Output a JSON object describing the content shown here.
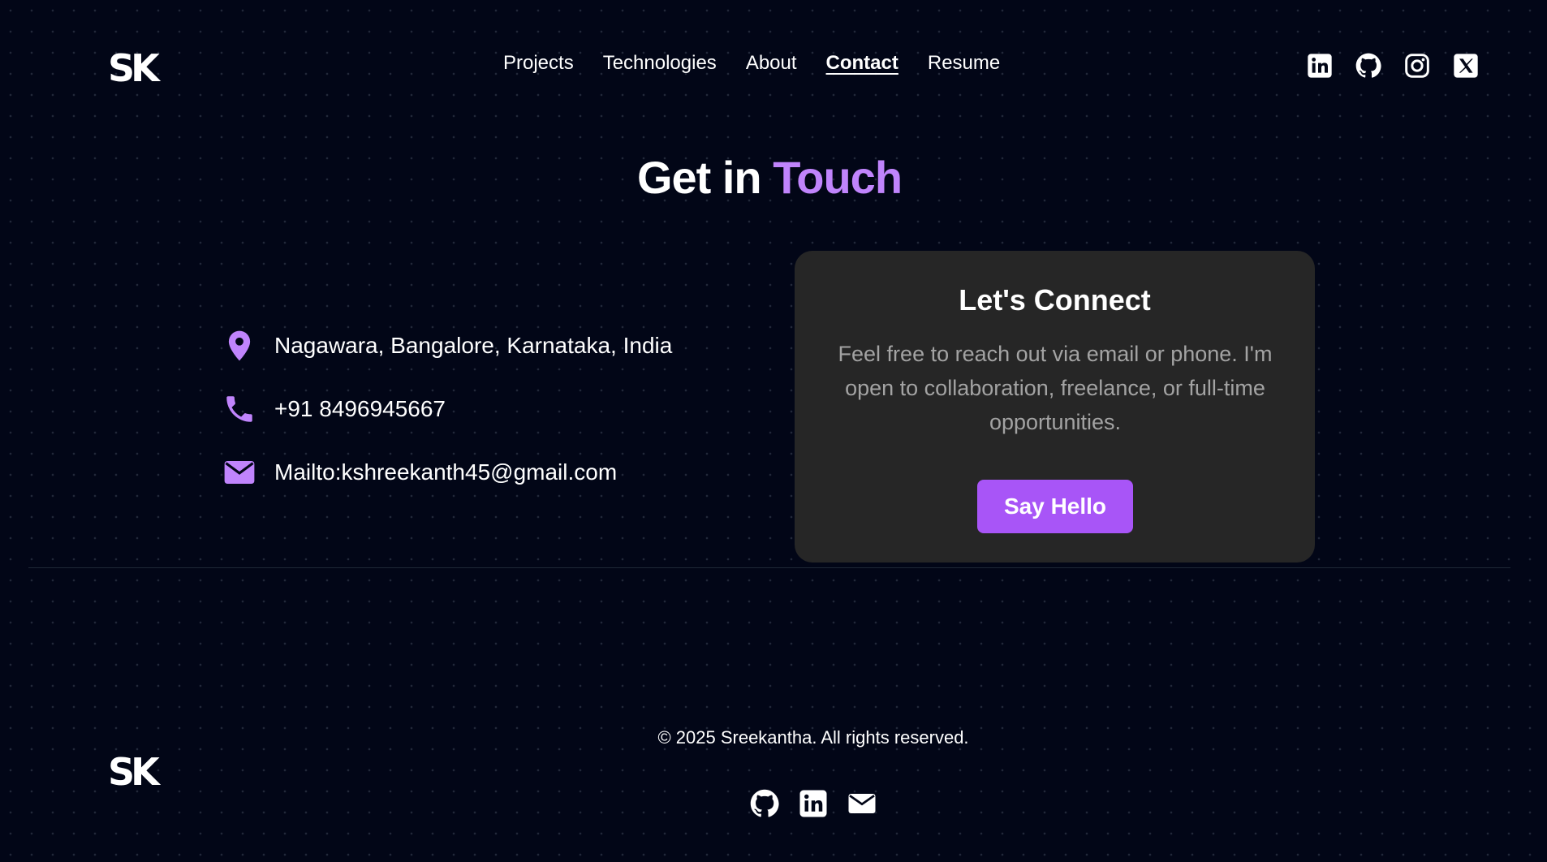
{
  "header": {
    "logo": "SK",
    "nav": [
      {
        "label": "Projects",
        "active": false
      },
      {
        "label": "Technologies",
        "active": false
      },
      {
        "label": "About",
        "active": false
      },
      {
        "label": "Contact",
        "active": true
      },
      {
        "label": "Resume",
        "active": false
      }
    ],
    "socials": [
      "linkedin-icon",
      "github-icon",
      "instagram-icon",
      "x-icon"
    ]
  },
  "contact": {
    "heading_main": "Get in",
    "heading_accent": "Touch",
    "location": "Nagawara, Bangalore, Karnataka, India",
    "phone": "+91 8496945667",
    "email": "Mailto:kshreekanth45@gmail.com",
    "icons": [
      "location-pin-icon",
      "phone-icon",
      "mail-icon"
    ]
  },
  "card": {
    "title": "Let's Connect",
    "text": "Feel free to reach out via email or phone. I'm open to collaboration, freelance, or full-time opportunities.",
    "button_label": "Say Hello"
  },
  "footer": {
    "logo": "SK",
    "copyright": "© 2025 Sreekantha. All rights reserved.",
    "icons": [
      "github-icon",
      "linkedin-icon",
      "mail-icon"
    ]
  },
  "colors": {
    "background": "#020617",
    "accent": "#c084fc",
    "button": "#a855f7",
    "card": "#262626",
    "muted_text": "#a3a3a3"
  }
}
